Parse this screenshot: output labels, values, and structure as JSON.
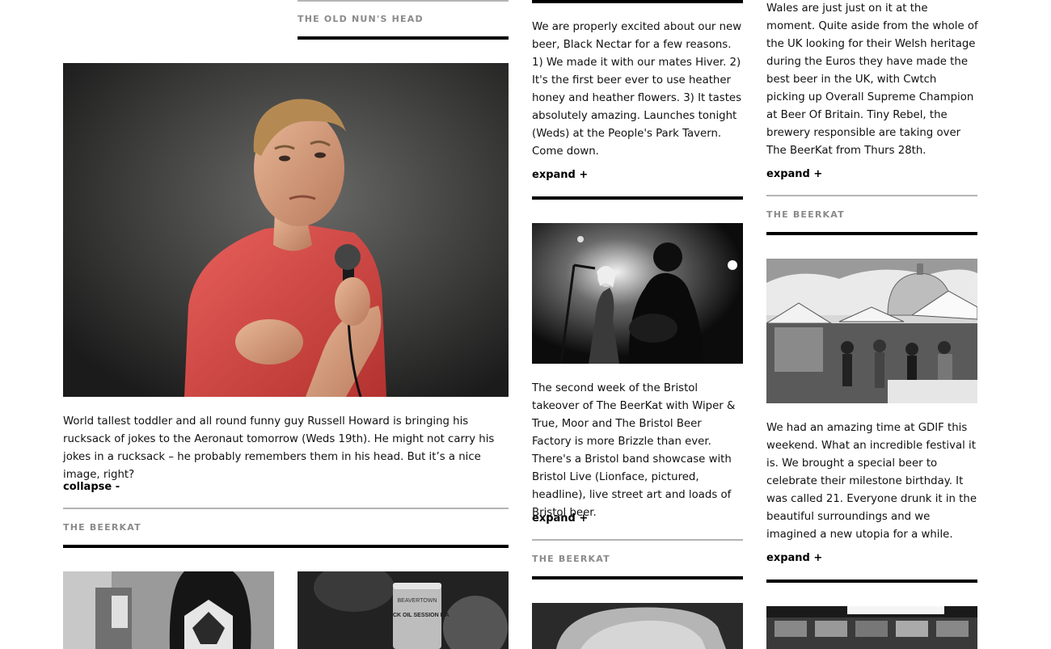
{
  "col1": {
    "top_venue": "THE OLD NUN'S HEAD",
    "feature": {
      "text": "World tallest toddler and all round funny guy Russell Howard is bringing his rucksack of jokes to the Aeronaut tomorrow (Weds 19th). He might not carry his jokes in a rucksack – he probably remembers them in his head. But it’s a nice image, right?",
      "toggle": "collapse -",
      "venue": "THE BEERKAT"
    }
  },
  "col2": {
    "post1": {
      "text": "We are properly excited about our new beer, Black Nectar for a few reasons. 1) We made it with our mates Hiver. 2) It's the first beer ever to use heather honey and heather flowers. 3) It tastes absolutely amazing. Launches tonight (Weds) at the People's Park Tavern. Come down.",
      "toggle": "expand +"
    },
    "post2": {
      "text": "The second week of the Bristol takeover of The BeerKat with Wiper & True, Moor and The Bristol Beer Factory is more Brizzle than ever. There's a Bristol band showcase with Bristol Live (Lionface, pictured, headline), live street art and loads of Bristol beer.",
      "toggle": "expand +",
      "venue": "THE BEERKAT"
    }
  },
  "col3": {
    "post1": {
      "text": "Wales are just just on it at the moment. Quite aside from the whole of the UK looking for their Welsh heritage during the Euros they have made the best beer in the UK, with Cwtch picking up Overall Supreme Champion at Beer Of Britain. Tiny Rebel, the brewery responsible are taking over The BeerKat from Thurs 28th.",
      "toggle": "expand +",
      "venue": "THE BEERKAT"
    },
    "post2": {
      "text": "We had an amazing time at GDIF this weekend. What an incredible festival it is. We brought a special beer to celebrate their milestone birthday. It was called 21. Everyone drunk it in the beautiful surroundings and we imagined a new utopia for a while.",
      "toggle": "expand +"
    }
  },
  "bottom_cans": {
    "can_text": "NECK OIL SESSION IPA",
    "brand_text": "BEAVERTOWN"
  }
}
